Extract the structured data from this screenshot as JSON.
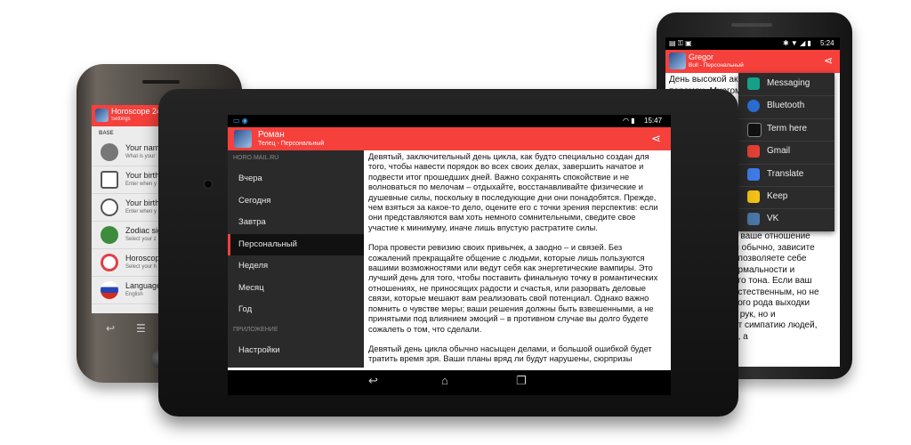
{
  "colors": {
    "accent": "#f5403c",
    "drawer_bg": "#2a2a2a",
    "statusbar": "#000000"
  },
  "left_phone": {
    "title": "Horoscope 24/",
    "subtitle": "Settings",
    "section": "BASE",
    "rows": [
      {
        "title": "Your name",
        "subtitle": "What is your",
        "icon": "person-icon"
      },
      {
        "title": "Your birth",
        "subtitle": "Enter when y",
        "icon": "calendar-icon"
      },
      {
        "title": "Your birth",
        "subtitle": "Enter when y",
        "icon": "clock-icon"
      },
      {
        "title": "Zodiac sig",
        "subtitle": "Select your z",
        "icon": "zodiac-icon"
      },
      {
        "title": "Horoscope",
        "subtitle": "Select your h",
        "icon": "horoscope-icon"
      },
      {
        "title": "Language",
        "subtitle": "English",
        "icon": "flag-icon"
      }
    ]
  },
  "tablet": {
    "status_time": "15:47",
    "app_title": "Роман",
    "app_subtitle": "Телец - Персональный",
    "drawer": {
      "section_top": "HORO.MAIL.RU",
      "items": [
        "Вчера",
        "Сегодня",
        "Завтра",
        "Персональный",
        "Неделя",
        "Месяц",
        "Год"
      ],
      "active_index": 3,
      "section_bottom": "ПРИЛОЖЕНИЕ",
      "bottom_items": [
        "Настройки"
      ]
    },
    "paragraphs": [
      "Девятый, заключительный день цикла, как будто специально создан для того, чтобы навести порядок во всех своих делах, завершить начатое и подвести итог прошедших дней. Важно сохранять спокойствие и не волноваться по мелочам – отдыхайте, восстанавливайте физические и душевные силы, поскольку в последующие дни они понадобятся. Прежде, чем взяться за какое-то дело, оцените его с точки зрения перспектив: если они представляются вам хоть немного сомнительными, сведите свое участие к минимуму, иначе лишь впустую растратите силы.",
      "Пора провести ревизию своих привычек, а заодно – и связей. Без сожалений прекращайте общение с людьми, которые лишь пользуются вашими возможностями или ведут себя как энергетические вампиры. Это лучший день для того, чтобы поставить финальную точку в романтических отношениях, не приносящих радости и счастья, или разорвать деловые связи, которые мешают вам реализовать свой потенциал. Однако важно помнить о чувстве меры; ваши решения должны быть взвешенными, а не принятыми под влиянием эмоций – в противном случае вы долго будете сожалеть о том, что сделали.",
      "Девятый день цикла обычно насыщен делами, и большой ошибкой будет тратить время зря. Ваши планы вряд ли будут нарушены, сюрпризы"
    ]
  },
  "right_phone": {
    "status_time": "5:24",
    "app_title": "Gregor",
    "app_subtitle": "Bull - Персональный",
    "text_top": "День высокой ак\nперемен. Многом",
    "text_bottom": "и ваше отношение\nм обычно, зависите\n, позволяете себе\nормальности и\nого тона. Если ваш\nестественным, но не\nвого рода выходки\nс рук, но и\nит симпатию людей,\nи, а"
  },
  "share_menu": {
    "items": [
      {
        "label": "Messaging",
        "icon": "messaging-icon",
        "color": "#16a08a"
      },
      {
        "label": "Bluetooth",
        "icon": "bluetooth-icon",
        "color": "#2b6cd1"
      },
      {
        "label": "Term here",
        "icon": "terminal-icon",
        "color": "#111111"
      },
      {
        "label": "Gmail",
        "icon": "gmail-icon",
        "color": "#e24034"
      },
      {
        "label": "Translate",
        "icon": "translate-icon",
        "color": "#3f7be7"
      },
      {
        "label": "Keep",
        "icon": "keep-icon",
        "color": "#f3c215"
      },
      {
        "label": "VK",
        "icon": "vk-icon",
        "color": "#4a76a8"
      }
    ]
  }
}
